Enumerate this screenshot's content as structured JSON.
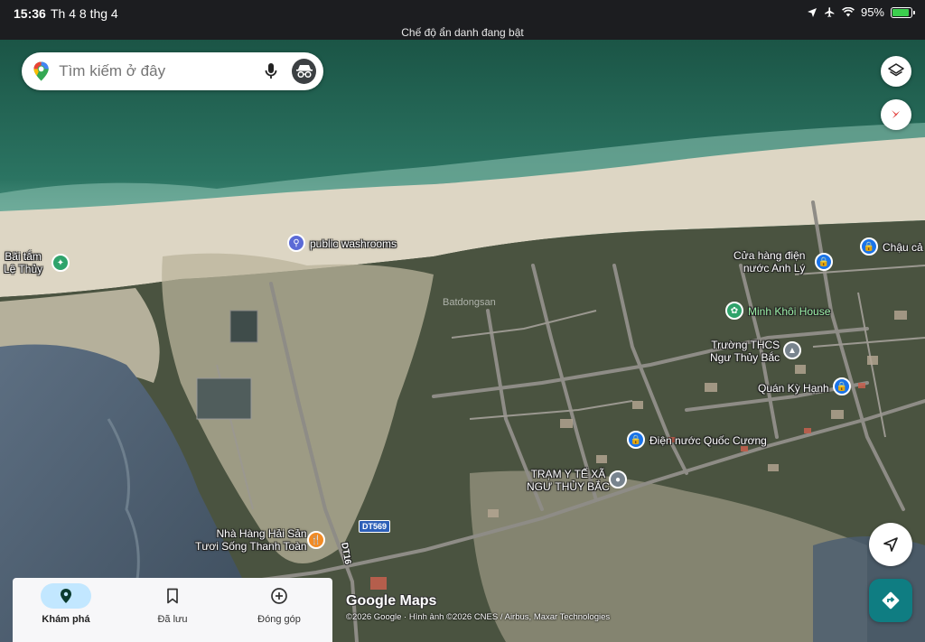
{
  "status_bar": {
    "time": "15:36",
    "date": "Th 4 8 thg 4",
    "battery": "95%",
    "battery_level": 0.95,
    "incognito_banner": "Chế độ ẩn danh đang bật"
  },
  "search": {
    "placeholder": "Tìm kiếm ở đây"
  },
  "places": {
    "bai_tam": "Bãi tắm\nLệ Thủy",
    "washrooms": "public washrooms",
    "cua_hang": "Cửa hàng điện\nnước Anh Lý",
    "chau_canh": "Chậu cả",
    "minh_khoi": "Minh Khôi House",
    "truong_thcs": "Trường THCS\nNgư Thủy Bắc",
    "quan_ky_hanh": "Quán Kỳ Hạnh",
    "dien_nuoc": "Điện nước Quốc Cương",
    "tram_y_te": "TRẠM Y TẾ XÃ\nNGƯ THỦY BẮC",
    "nha_hang": "Nhà Hàng Hải Sản\nTươi Sống Thanh Toàn"
  },
  "roads": {
    "dt569": "DT569",
    "dt16": "DT16"
  },
  "watermark": "Batdongsan",
  "attribution": {
    "logo": "Google Maps",
    "text": "©2026 Google · Hình ảnh ©2026 CNES / Airbus, Maxar Technologies"
  },
  "bottom_nav": {
    "items": [
      {
        "label": "Khám phá",
        "icon": "explore-pin-icon",
        "active": true
      },
      {
        "label": "Đã lưu",
        "icon": "bookmark-icon",
        "active": false
      },
      {
        "label": "Đóng góp",
        "icon": "add-circle-icon",
        "active": false
      }
    ]
  },
  "colors": {
    "sea_deep": "#1e5a4c",
    "sea_shallow": "#3f8a79",
    "sand": "#d9d2c0",
    "vegetation": "#3d4a36",
    "lagoon": "#4b5f74",
    "accent_blue": "#1a73e8",
    "directions_teal": "#0f7d82",
    "nav_active": "#c2e7ff"
  }
}
